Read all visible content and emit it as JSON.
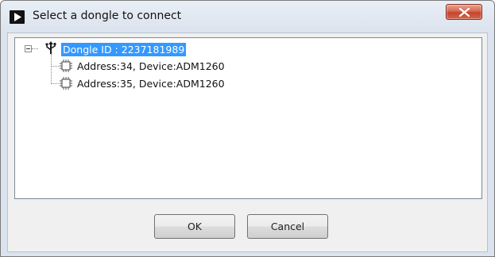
{
  "window": {
    "title": "Select a dongle to connect"
  },
  "tree": {
    "root": {
      "label": "Dongle ID : 2237181989",
      "icon": "usb-icon",
      "expanded": true,
      "selected": true
    },
    "children": [
      {
        "label": "Address:34, Device:ADM1260",
        "icon": "chip-icon"
      },
      {
        "label": "Address:35, Device:ADM1260",
        "icon": "chip-icon"
      }
    ]
  },
  "buttons": {
    "ok_label": "OK",
    "cancel_label": "Cancel"
  },
  "colors": {
    "selection": "#3399ff",
    "close_button": "#c7442b"
  }
}
